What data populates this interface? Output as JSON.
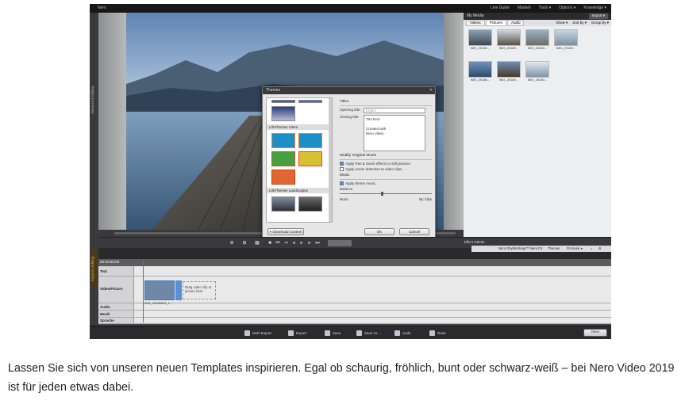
{
  "app": {
    "title": "Nero",
    "menu": [
      "Live Guide",
      "MarketI",
      "Tools ▾",
      "Options ▾",
      "Knowledge ▾"
    ]
  },
  "left_tabs": {
    "advanced": "Advanced Editing",
    "express": "Express Editing"
  },
  "dialog": {
    "title": "Themes",
    "close_glyph": "✕",
    "groups": [
      "LifeThemes Cities",
      "LifeThemes Landscapes"
    ],
    "titles_section": "Titles",
    "opening_label": "Opening title:",
    "opening_placeholder": "Dbject",
    "closing_label": "Closing title:",
    "closing_value": "The End\n\nCreated with\nNero Video",
    "modify_section": "Modify Original Movie",
    "chk_pan": "Apply Pan & Zoom effects to still pictures",
    "chk_scene": "Apply scene detection to video clips",
    "music_section": "Music",
    "chk_music": "Apply theme music",
    "balance_label": "Balance",
    "balance_left": "Music",
    "balance_right": "My Clips",
    "balance_value": 0.45,
    "download_button": "Download Content",
    "ok_button": "OK",
    "cancel_button": "Cancel"
  },
  "media": {
    "header": "My Media",
    "import_button": "Import ▾",
    "tabs": [
      "Videos",
      "Pictures",
      "Audio"
    ],
    "tools": [
      "Show ▾",
      "Sort by ▾",
      "Group by ▾"
    ],
    "items": [
      "IMG_20180...",
      "IMG_20180...",
      "IMG_20180...",
      "IMG_20180...",
      "IMG_20180...",
      "IMG_20180...",
      "IMG_20180..."
    ]
  },
  "effect_palette": {
    "label": "Effect Palette",
    "items": [
      "Nero RhythmSnap™",
      "Nero FX",
      "Themes",
      "Fit music ▾"
    ]
  },
  "timeline": {
    "timecode": "00:00:00:00",
    "tracks": [
      "Text",
      "Video/Picture",
      "Audio",
      "Musik",
      "Sprache"
    ],
    "dropzone": "Drag video clip or picture here",
    "clip_label": "IMG_20180811_1..."
  },
  "bottom": {
    "buttons": [
      "Multi Export",
      "Export",
      "Save",
      "Save As ...",
      "Undo",
      "Redo"
    ],
    "next": "Next"
  },
  "caption": "Lassen Sie sich von unseren neuen Templates inspirieren. Egal ob schaurig, fröhlich, bunt oder schwarz-weiß – bei Nero Video 2019 ist für jeden etwas dabei."
}
